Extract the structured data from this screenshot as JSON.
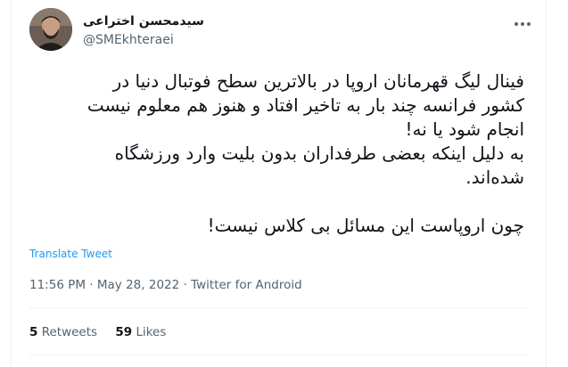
{
  "author": {
    "display_name": "سیدمحسن اختراعی",
    "handle": "@SMEkhteraei"
  },
  "tweet": {
    "lines": [
      "فینال لیگ قهرمانان اروپا در بالاترین سطح فوتبال دنیا در",
      "کشور فرانسه چند بار به تاخیر افتاد و هنوز هم معلوم نیست",
      "انجام شود یا نه!",
      "به دلیل اینکه بعضی طرفداران بدون بلیت وارد ورزشگاه",
      "شده‌اند.",
      "چون اروپاست این مسائل بی کلاس نیست!"
    ]
  },
  "translate_label": "Translate Tweet",
  "meta": {
    "time": "11:56 PM",
    "separator": "·",
    "date": "May 28, 2022",
    "source": "Twitter for Android"
  },
  "stats": {
    "retweets_count": "5",
    "retweets_label": "Retweets",
    "likes_count": "59",
    "likes_label": "Likes"
  },
  "colors": {
    "link": "#1d9bf0",
    "secondary_text": "#536471",
    "primary_text": "#0f1419",
    "divider": "#eff3f4"
  },
  "icons": {
    "more": "more-horizontal-icon"
  }
}
